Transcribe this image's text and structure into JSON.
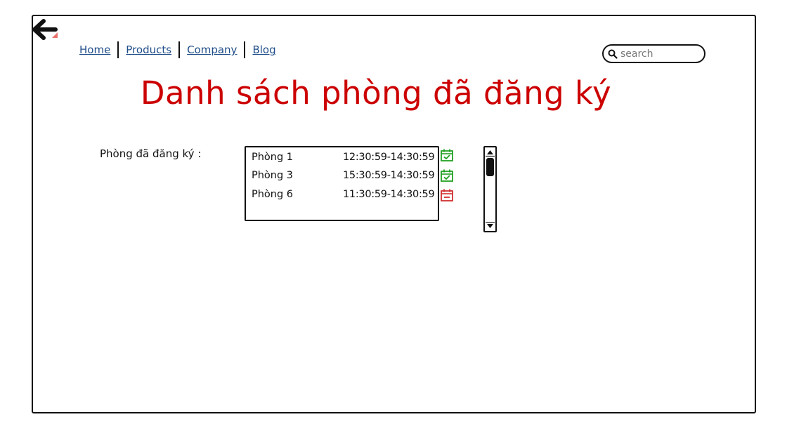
{
  "nav": {
    "items": [
      {
        "label": "Home"
      },
      {
        "label": "Products"
      },
      {
        "label": "Company"
      },
      {
        "label": "Blog"
      }
    ]
  },
  "search": {
    "placeholder": "search",
    "icon": "search-icon"
  },
  "back": {
    "icon": "back-arrow-icon"
  },
  "page": {
    "title": "Danh sách phòng đã đăng ký",
    "label": "Phòng đã đăng ký :"
  },
  "bookings": [
    {
      "room": "Phòng 1",
      "time": "12:30:59-14:30:59",
      "status": "confirmed",
      "icon": "calendar-check-icon",
      "color": "#22a022"
    },
    {
      "room": "Phòng 3",
      "time": "15:30:59-14:30:59",
      "status": "confirmed",
      "icon": "calendar-check-icon",
      "color": "#22a022"
    },
    {
      "room": "Phòng 6",
      "time": "11:30:59-14:30:59",
      "status": "removed",
      "icon": "calendar-minus-icon",
      "color": "#d03030"
    }
  ],
  "colors": {
    "title": "#cc0000",
    "link": "#1f4d8a"
  }
}
